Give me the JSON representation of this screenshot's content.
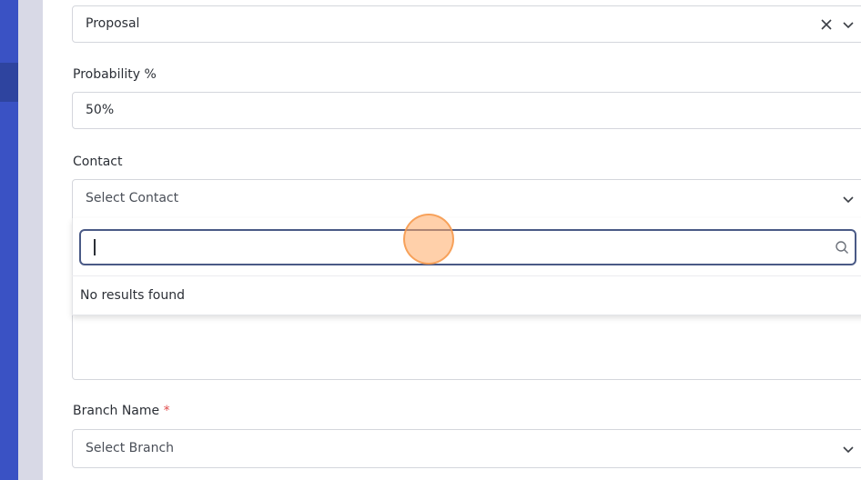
{
  "form": {
    "stage": {
      "value": "Proposal"
    },
    "probability": {
      "label": "Probability %",
      "value": "50%"
    },
    "contact": {
      "label": "Contact",
      "placeholder": "Select Contact",
      "dropdown": {
        "search_value": "",
        "no_results": "No results found"
      }
    },
    "branch": {
      "label": "Branch Name",
      "required_mark": "*",
      "placeholder": "Select Branch"
    }
  },
  "icons": {
    "clear": "close-icon",
    "chevron": "chevron-down-icon",
    "search": "search-icon"
  },
  "colors": {
    "sidebar": "#3a52c4",
    "focus_border": "#4a5a86",
    "required": "#e04b4b"
  }
}
